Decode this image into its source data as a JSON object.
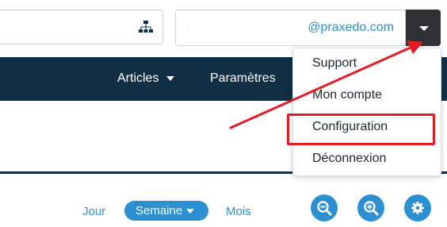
{
  "header": {
    "user_email": "@praxedo.com",
    "user_email_redacted": "·"
  },
  "nav": {
    "articles_label": "Articles",
    "parametres_label": "Paramètres"
  },
  "user_menu": {
    "items": [
      {
        "label": "Support"
      },
      {
        "label": "Mon compte"
      },
      {
        "label": "Configuration"
      },
      {
        "label": "Déconnexion"
      }
    ],
    "highlighted_item": "Configuration"
  },
  "view_switch": {
    "day_label": "Jour",
    "week_label": "Semaine",
    "month_label": "Mois",
    "selected": "Semaine"
  },
  "icons": {
    "hierarchy": "sitemap-icon",
    "menu_toggle": "caret-down-icon",
    "zoom_out": "zoom-out-icon",
    "zoom_in": "zoom-in-icon",
    "settings": "gear-icon"
  },
  "colors": {
    "navbar": "#102f45",
    "accent": "#2c8fd2",
    "dropdown_button": "#2f3235",
    "annotation_red": "#e31c23"
  }
}
